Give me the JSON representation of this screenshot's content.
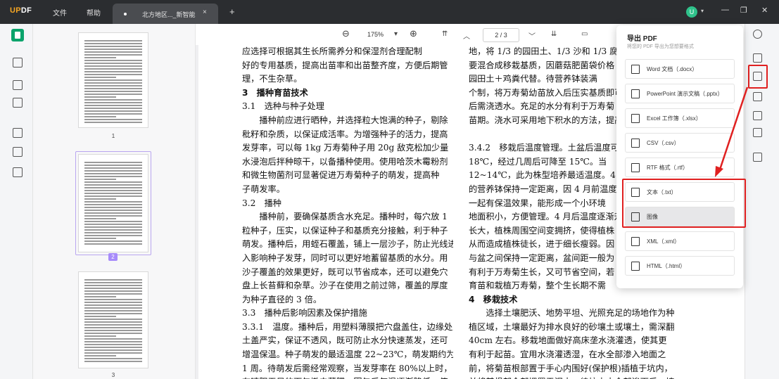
{
  "app": {
    "logo_main": "UP",
    "logo_accent": "DF"
  },
  "menu": {
    "file": "文件",
    "help": "帮助"
  },
  "tab": {
    "title": "北方地区..._新智能",
    "close": "×",
    "add": "+"
  },
  "user": {
    "avatar_letter": "U"
  },
  "window": {
    "minimize": "—",
    "maximize": "❐",
    "close": "✕"
  },
  "toolbar": {
    "zoom_out": "⊖",
    "zoom": "175%",
    "zoom_caret": "▾",
    "zoom_in": "⊕",
    "first": "⇈",
    "prev": "︿",
    "page": "2 / 3",
    "next": "﹀",
    "last": "⇊",
    "comment": "▭"
  },
  "thumbs": [
    {
      "num": "1"
    },
    {
      "num": "2"
    },
    {
      "num": "3"
    }
  ],
  "document": {
    "left_lines": [
      "应选择可根据其生长所需养分和保湿剂合理配制",
      "好的专用基质，提高出苗率和出苗整齐度，方便后期管",
      "理，不生杂草。",
      "3　播种育苗技术",
      "3.1　选种与种子处理",
      "　　播种前应进行晒种，并选择粒大饱满的种子，剔除",
      "秕籽和杂质，以保证成活率。为增强种子的活力，提高",
      "发芽率，可以每 1kg 万寿菊种子用 20g 敌克松加少量",
      "水浸泡后拌种晾干，以备播种使用。使用哈茨木霉粉剂",
      "和微生物菌剂可显著促进万寿菊种子的萌发，提高种",
      "子萌发率。",
      "3.2　播种",
      "　　播种前，要确保基质含水充足。播种时，每穴放 1",
      "粒种子，压实，以保证种子和基质充分接触，利于种子",
      "萌发。播种后，用蛭石覆盖，铺上一层沙子，防止光线进",
      "入影响种子发芽，同时可以更好地蓄留基质的水分。用",
      "沙子覆盖的效果更好，既可以节省成本，还可以避免穴",
      "盘上长苔藓和杂草。沙子在使用之前过筛，覆盖的厚度",
      "为种子直径的 3 倍。",
      "3.3　播种后影响因素及保护措施",
      "3.3.1　温度。播种后，用塑料薄膜把穴盘盖住，边缘处用",
      "土盖严实，保证不透风，既可防止水分快速蒸发，还可",
      "增温保温。种子萌发的最适温度 22~23℃，萌发期约为",
      "1 周。待萌发后需经常观察，当发芽率在 80%以上时，",
      "在晴阳无风的下午撤去薄膜，因午后气温逐渐降低，使"
    ],
    "right_lines": [
      "地，将 1/3 的园田土、1/3 沙和 1/3 腐熟的",
      "要混合成移栽基质，因蘑菇肥菌袋价格",
      "园田土＋鸡粪代替。待营养钵装满",
      "个制，将万寿菊幼苗放入后压实基质即可",
      "后需浇透水。充足的水分有利于万寿菊",
      "苗期。浇水可采用地下积水的方法，提高",
      "",
      "3.4.2　移栽后温度管理。土盆后温度可",
      "18℃，经过几周后可降至 15℃。当",
      "12~14℃，此为株型培养最适温度。4 月",
      "的营养钵保持一定距离，因 4 月前温度",
      "一起有保温效果，能形成一个小环境",
      "地面积小，方便管理。4 月后温度逐渐升高",
      "长大，植株周围空间变拥挤，使得植株",
      "从而造成植株徒长，进于细长瘦弱。因",
      "与盆之间保持一定距离，盆间距一般为",
      "有利于万寿菊生长，又可节省空间，若",
      "育苗和栽植万寿菊，整个生长期不需",
      "4　移栽技术",
      "　　选择土壤肥沃、地势平坦、光照充足的场地作为种",
      "植区域，土壤最好为排水良好的砂壤土或壤土，需深翻",
      "40cm 左右。移栽地面做好高床垄水浇灌透，使其更",
      "有利于起苗。宜用水浇灌透湿，在水全部渗入地面之",
      "前，将菊苗根部置于手心内围好(保护根)插植于坑内，",
      "并将其根部全部埋置于泥中。待坑内水全部渗下后，填"
    ]
  },
  "export_panel": {
    "title": "导出 PDF",
    "subtitle": "将您的 PDF 导出为您想要格式",
    "items": [
      {
        "label": "Word 文档（.docx）"
      },
      {
        "label": "PowerPoint 演示文稿（.pptx）"
      },
      {
        "label": "Excel 工作簿（.xlsx）"
      },
      {
        "label": "CSV（.csv）"
      },
      {
        "label": "RTF 格式（.rtf）"
      },
      {
        "label": "文本（.txt）"
      },
      {
        "label": "图像"
      },
      {
        "label": "XML（.xml）"
      },
      {
        "label": "HTML（.html）"
      }
    ]
  },
  "colors": {
    "accent_green": "#0aa36b",
    "highlight_red": "#e02020",
    "selection_purple": "#a78bfa"
  }
}
